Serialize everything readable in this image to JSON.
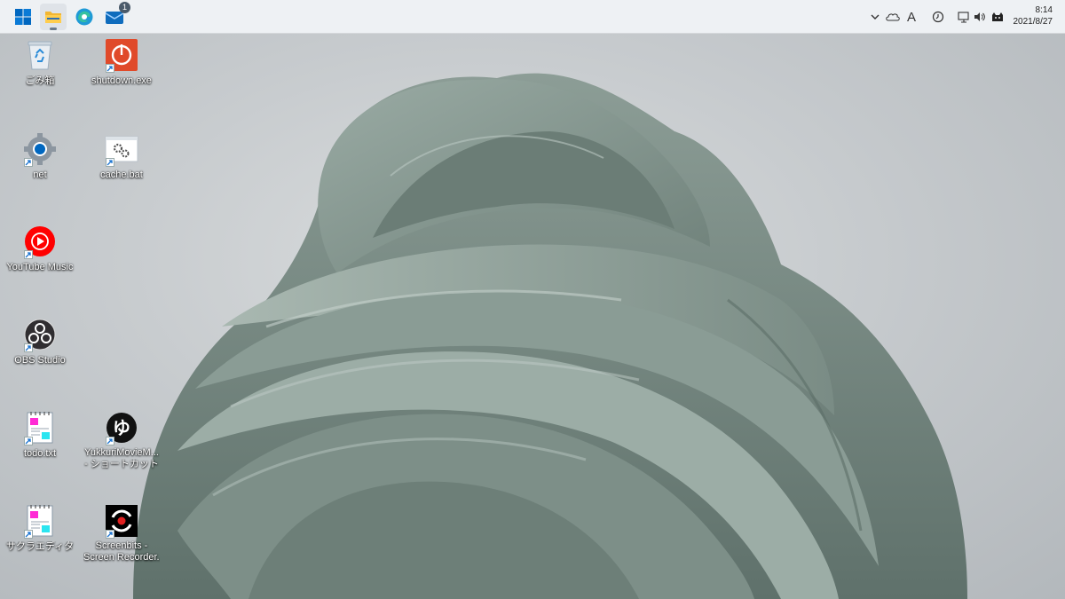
{
  "taskbar": {
    "apps": [
      {
        "name": "start",
        "icon": "windows-logo-icon"
      },
      {
        "name": "file-explorer",
        "icon": "folder-icon"
      },
      {
        "name": "edge",
        "icon": "edge-browser-icon"
      },
      {
        "name": "mail",
        "icon": "mail-icon",
        "badge": "1"
      }
    ],
    "tray": {
      "ime_mode": "A",
      "time": "8:14",
      "date": "2021/8/27"
    }
  },
  "desktop": {
    "icons": [
      {
        "label": "ごみ箱",
        "icon": "recycle-bin-icon"
      },
      {
        "label": "shutdown.exe",
        "icon": "power-icon"
      },
      {
        "label": "net",
        "icon": "settings-gear-icon"
      },
      {
        "label": "cache.bat",
        "icon": "batch-file-gears-icon"
      },
      {
        "label": "YouTube Music",
        "icon": "youtube-music-icon"
      },
      {
        "label": "OBS Studio",
        "icon": "obs-studio-icon"
      },
      {
        "label": "todo.txt",
        "icon": "notepad-icon"
      },
      {
        "label": "YukkuriMovieM...",
        "label2": "- ショートカット",
        "icon": "yukkuri-movie-maker-icon"
      },
      {
        "label": "サクラエディタ",
        "icon": "sakura-editor-icon"
      },
      {
        "label": "Screenbits -",
        "label2": "Screen Recorder...",
        "icon": "screenbits-recorder-icon"
      }
    ]
  },
  "colors": {
    "taskbar_bg": "#eef1f4",
    "accent_blue": "#0067c0",
    "youtube_red": "#ff0000",
    "shutdown_red": "#e04a2a",
    "wallpaper_fabric": "#7f918a"
  }
}
